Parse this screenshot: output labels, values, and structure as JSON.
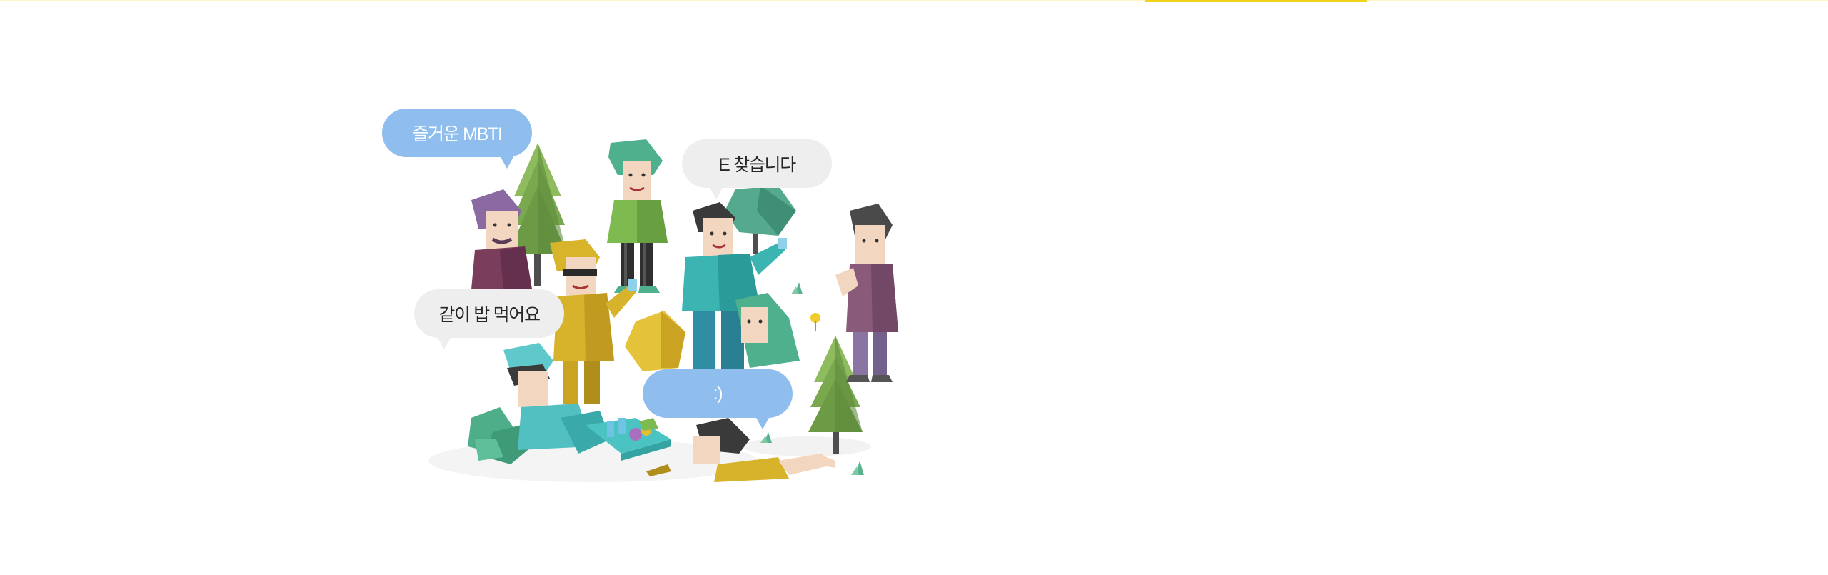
{
  "colors": {
    "top_rule": "#fbf7c6",
    "top_accent": "#f2d31b",
    "bubble_blue": "#8fbdee",
    "bubble_grey": "#eeeeee"
  },
  "illustration": {
    "bubbles": {
      "mbti": "즐거운 MBTI",
      "find_e": "E 찾습니다",
      "eat_together": "같이 밥 먹어요",
      "smile": ":)"
    }
  }
}
